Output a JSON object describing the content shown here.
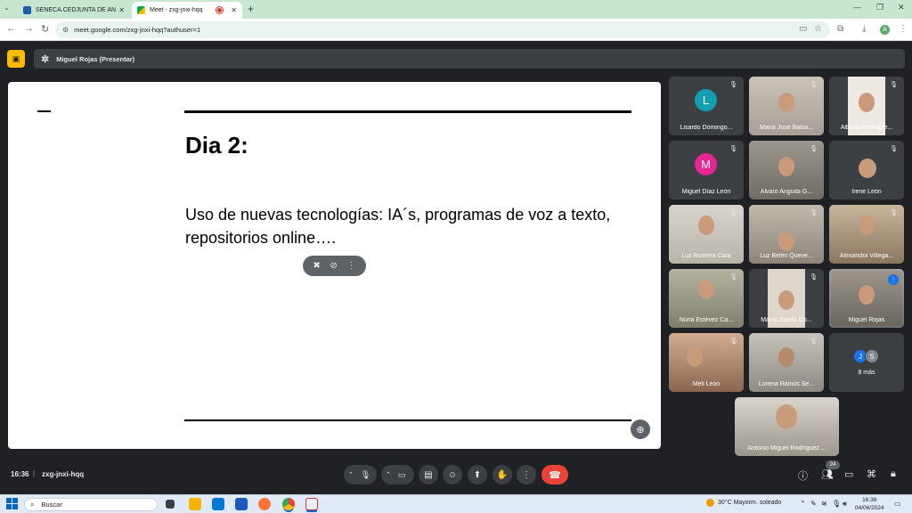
{
  "browser": {
    "tabs": [
      {
        "title": "SENECA.CEDJUNTA DE AND",
        "close": "✕"
      },
      {
        "title": "Meet - zxg-jnxi-hqq",
        "close": "✕"
      }
    ],
    "new_tab": "+",
    "url": "meet.google.com/zxg-jnxi-hqq?authuser=1",
    "profile_initial": "A",
    "window_controls": [
      "—",
      "❐",
      "✕"
    ]
  },
  "meet": {
    "presenter_label": "Miguel Rojas (Presentar)",
    "slide": {
      "title": "Dia 2:",
      "body": "Uso de nuevas tecnologías: IA´s, programas de voz a texto, repositorios online…."
    },
    "participants": [
      {
        "name": "Lisardo Domingo...",
        "avatar": "L",
        "color": "#129eaf",
        "video": false
      },
      {
        "name": "María José Balsa...",
        "video": true,
        "bg": "#b9b2a6"
      },
      {
        "name": "Alberto Rodrigue...",
        "video": true,
        "bg": "#d9d4cc"
      },
      {
        "name": "Miguel Díaz León",
        "avatar": "M",
        "color": "#e52592",
        "video": false
      },
      {
        "name": "Álvaro Anguita G...",
        "video": true,
        "bg": "#8d8a83"
      },
      {
        "name": "Irene León",
        "video": true,
        "bg": "#3c4043"
      },
      {
        "name": "Luz Romera Cara",
        "video": true,
        "bg": "#c7c2b8"
      },
      {
        "name": "Luz Belén Queve...",
        "video": true,
        "bg": "#a89f93"
      },
      {
        "name": "Alexandra Villega...",
        "video": true,
        "bg": "#b7a58f"
      },
      {
        "name": "Nuria Estévez Ca...",
        "video": true,
        "bg": "#9d9b88"
      },
      {
        "name": "María Josefa Gó...",
        "video": true,
        "bg": "#cfc8bc"
      },
      {
        "name": "Miguel Rojas",
        "video": true,
        "bg": "#8f8a80",
        "speaking": true
      },
      {
        "name": "Meli León",
        "video": true,
        "bg": "#b88c72"
      },
      {
        "name": "Lorena Ramos Se...",
        "video": true,
        "bg": "#a7a49e"
      }
    ],
    "more": {
      "initials": [
        "J",
        "S"
      ],
      "colors": [
        "#1a73e8",
        "#80868b"
      ],
      "label": "8 más"
    },
    "self_view": {
      "name": "Antonio Miguel Rodríguez ..."
    },
    "time": "16:36",
    "separator": "|",
    "meeting_code": "zxg-jnxi-hqq",
    "people_count": "24"
  },
  "taskbar": {
    "search_placeholder": "Buscar",
    "weather": "30°C  Mayorm. soleado",
    "time": "16:36",
    "date": "04/06/2024"
  }
}
